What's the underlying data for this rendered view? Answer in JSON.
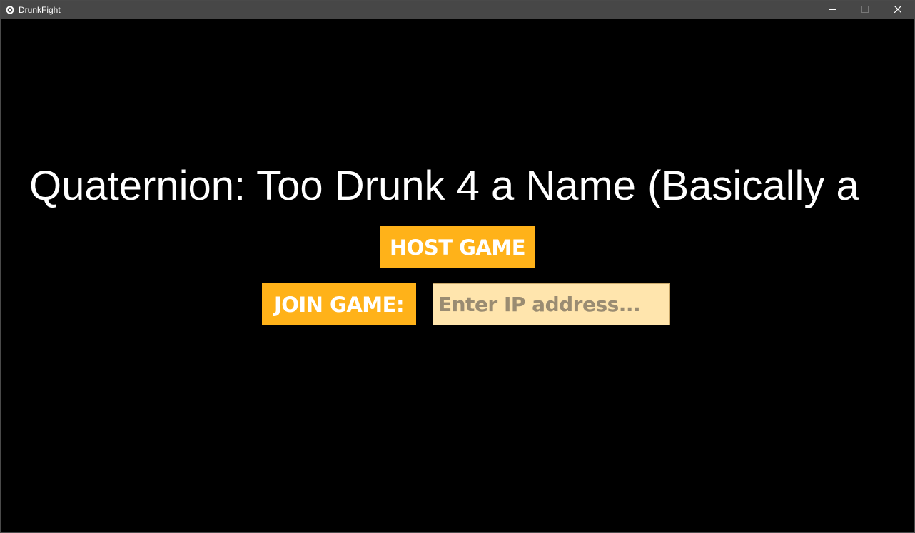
{
  "window": {
    "title": "DrunkFight",
    "app_icon": "unity-logo-icon",
    "controls": [
      "minimize-icon",
      "maximize-icon",
      "close-icon"
    ]
  },
  "menu": {
    "title": "Quaternion: Too Drunk 4 a Name (Basically a",
    "host_label": "HOST GAME",
    "join_label": "JOIN GAME:",
    "ip_input": {
      "value": "",
      "placeholder": "Enter IP address..."
    }
  },
  "colors": {
    "background": "#000000",
    "titlebar": "#474747",
    "button": "#ffb219",
    "input_bg": "#ffe5ad",
    "text": "#ffffff"
  }
}
